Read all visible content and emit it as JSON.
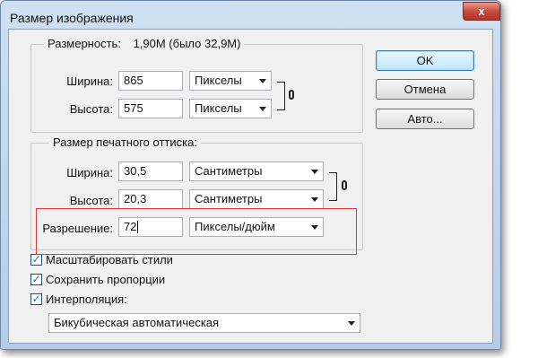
{
  "dialog": {
    "title": "Размер изображения",
    "close_glyph": "x"
  },
  "pixel_dimensions": {
    "label": "Размерность:",
    "value": "1,90M (было 32,9M)",
    "width_label": "Ширина:",
    "width_value": "865",
    "width_unit": "Пикселы",
    "height_label": "Высота:",
    "height_value": "575",
    "height_unit": "Пикселы"
  },
  "document_size": {
    "legend": "Размер печатного оттиска:",
    "width_label": "Ширина:",
    "width_value": "30,5",
    "width_unit": "Сантиметры",
    "height_label": "Высота:",
    "height_value": "20,3",
    "height_unit": "Сантиметры",
    "resolution_label": "Разрешение:",
    "resolution_value": "72",
    "resolution_unit": "Пикселы/дюйм"
  },
  "buttons": {
    "ok": "OK",
    "cancel": "Отмена",
    "auto": "Авто..."
  },
  "options": {
    "scale_styles": {
      "label": "Масштабировать стили",
      "checked": true
    },
    "constrain_proportions": {
      "label": "Сохранить пропорции",
      "checked": true
    },
    "resample": {
      "label": "Интерполяция:",
      "checked": true
    },
    "resample_method": "Бикубическая автоматическая"
  },
  "colors": {
    "highlight": "#e03a3a",
    "close_button": "#c5483a"
  },
  "icons": {
    "chain_link": "chain-link-icon",
    "dropdown_arrow": "chevron-down-icon",
    "checkmark": "checkmark-icon"
  }
}
